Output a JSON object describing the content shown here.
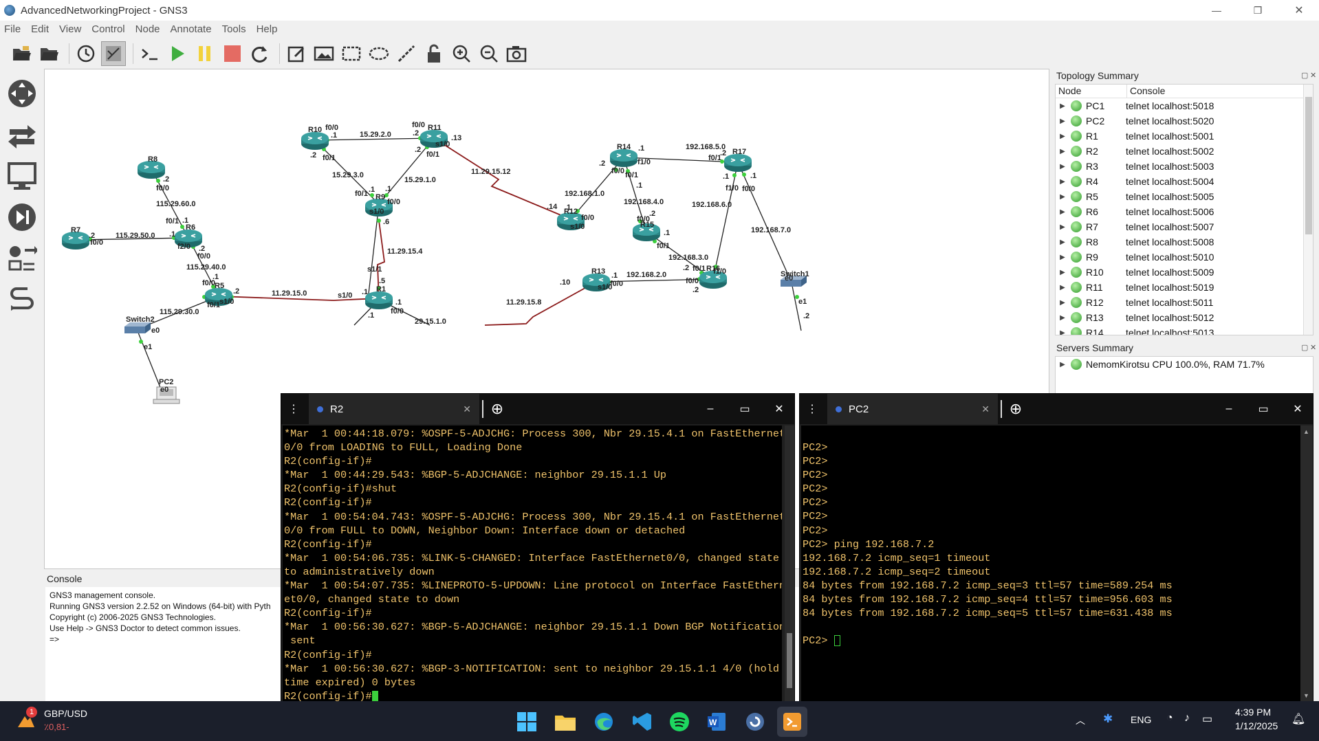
{
  "window": {
    "title": "AdvancedNetworkingProject - GNS3",
    "minimize": "—",
    "maximize": "❐",
    "close": "✕"
  },
  "menu": [
    "File",
    "Edit",
    "View",
    "Control",
    "Node",
    "Annotate",
    "Tools",
    "Help"
  ],
  "toolbar": {
    "icons": [
      "open-project-icon",
      "open-folder-icon",
      "snapshot-icon",
      "show-interfaces-icon",
      "console-all-icon",
      "start-icon",
      "suspend-icon",
      "stop-icon",
      "reload-icon",
      "note-icon",
      "image-icon",
      "rectangle-icon",
      "ellipse-icon",
      "line-icon",
      "lock-icon",
      "zoom-in-icon",
      "zoom-out-icon",
      "screenshot-icon"
    ]
  },
  "leftdock": {
    "icons": [
      "browse-routers-icon",
      "browse-switches-icon",
      "browse-end-devices-icon",
      "browse-security-icon",
      "browse-all-devices-icon",
      "add-link-icon"
    ]
  },
  "topology": {
    "nodes": [
      {
        "name": "R8",
        "type": "router"
      },
      {
        "name": "R7",
        "type": "router"
      },
      {
        "name": "R6",
        "type": "router"
      },
      {
        "name": "R5",
        "type": "router"
      },
      {
        "name": "R10",
        "type": "router"
      },
      {
        "name": "R11",
        "type": "router"
      },
      {
        "name": "R9",
        "type": "router"
      },
      {
        "name": "R1",
        "type": "router"
      },
      {
        "name": "R12",
        "type": "router"
      },
      {
        "name": "R14",
        "type": "router"
      },
      {
        "name": "R15",
        "type": "router"
      },
      {
        "name": "R13",
        "type": "router"
      },
      {
        "name": "R16",
        "type": "router"
      },
      {
        "name": "R17",
        "type": "router"
      },
      {
        "name": "Switch2",
        "type": "switch"
      },
      {
        "name": "Switch1",
        "type": "switch"
      },
      {
        "name": "PC2",
        "type": "pc"
      }
    ],
    "labels": [
      ".2",
      "f0/0",
      "115.29.60.0",
      "f0/1",
      ".1",
      ".2",
      ".1",
      "f0/0",
      "115.29.50.0",
      "f2/0",
      ".2",
      "f0/0",
      "115.29.40.0",
      ".1",
      "f0/0",
      ".2",
      "s1/0",
      "f0/1",
      "11.29.15.0",
      "s1/0",
      ".1",
      "115.29.30.0",
      "e0",
      "e1",
      "e0",
      "f0/0",
      "f0/0",
      ".1",
      "15.29.2.0",
      ".2",
      ".13",
      "s1/0",
      ".2",
      "f0/1",
      ".2",
      "f0/1",
      "15.29.3.0",
      "15.29.1.0",
      "f0/1",
      ".1",
      ".1",
      "f0/0",
      "s1/0",
      ".6",
      "11.29.15.4",
      "s1/1",
      ".5",
      ".1",
      "f0/0",
      "29.15.1.0",
      ".1",
      "11.29.15.12",
      ".14",
      ".1",
      "f0/0",
      "s1/0",
      "192.168.1.0",
      ".2",
      "f0/0",
      ".1",
      "f1/0",
      "f0/1",
      ".1",
      "192.168.4.0",
      "f0/0",
      ".2",
      ".1",
      "f0/1",
      "192.168.3.0",
      ".2",
      "f0/1",
      "f1/0",
      ".2",
      "192.168.5.0",
      ".2",
      "f0/1",
      ".1",
      ".1",
      "f1/0",
      "f0/0",
      "192.168.6.0",
      "192.168.7.0",
      ".10",
      ".1",
      "f0/0",
      "s1/0",
      "192.168.2.0",
      "f0/0",
      ".2",
      "11.29.15.8",
      "e0",
      "e1",
      ".2"
    ]
  },
  "console_dock": {
    "title": "Console",
    "lines": [
      "GNS3 management console.",
      "Running GNS3 version 2.2.52 on Windows (64-bit) with Pyth",
      "Copyright (c) 2006-2025 GNS3 Technologies.",
      "Use Help -> GNS3 Doctor to detect common issues.",
      "",
      "=>"
    ]
  },
  "topology_summary": {
    "title": "Topology Summary",
    "col_node": "Node",
    "col_console": "Console",
    "rows": [
      {
        "node": "PC1",
        "console": "telnet localhost:5018"
      },
      {
        "node": "PC2",
        "console": "telnet localhost:5020"
      },
      {
        "node": "R1",
        "console": "telnet localhost:5001"
      },
      {
        "node": "R2",
        "console": "telnet localhost:5002"
      },
      {
        "node": "R3",
        "console": "telnet localhost:5003"
      },
      {
        "node": "R4",
        "console": "telnet localhost:5004"
      },
      {
        "node": "R5",
        "console": "telnet localhost:5005"
      },
      {
        "node": "R6",
        "console": "telnet localhost:5006"
      },
      {
        "node": "R7",
        "console": "telnet localhost:5007"
      },
      {
        "node": "R8",
        "console": "telnet localhost:5008"
      },
      {
        "node": "R9",
        "console": "telnet localhost:5010"
      },
      {
        "node": "R10",
        "console": "telnet localhost:5009"
      },
      {
        "node": "R11",
        "console": "telnet localhost:5019"
      },
      {
        "node": "R12",
        "console": "telnet localhost:5011"
      },
      {
        "node": "R13",
        "console": "telnet localhost:5012"
      },
      {
        "node": "R14",
        "console": "telnet localhost:5013"
      }
    ]
  },
  "servers_summary": {
    "title": "Servers Summary",
    "server": "NemomKirotsu CPU 100.0%, RAM 71.7%"
  },
  "terminal_r2": {
    "tab": "R2",
    "lines": [
      "*Mar  1 00:44:18.079: %OSPF-5-ADJCHG: Process 300, Nbr 29.15.4.1 on FastEthernet",
      "0/0 from LOADING to FULL, Loading Done",
      "R2(config-if)#",
      "*Mar  1 00:44:29.543: %BGP-5-ADJCHANGE: neighbor 29.15.1.1 Up",
      "R2(config-if)#shut",
      "R2(config-if)#",
      "*Mar  1 00:54:04.743: %OSPF-5-ADJCHG: Process 300, Nbr 29.15.4.1 on FastEthernet",
      "0/0 from FULL to DOWN, Neighbor Down: Interface down or detached",
      "R2(config-if)#",
      "*Mar  1 00:54:06.735: %LINK-5-CHANGED: Interface FastEthernet0/0, changed state",
      "to administratively down",
      "*Mar  1 00:54:07.735: %LINEPROTO-5-UPDOWN: Line protocol on Interface FastEthern",
      "et0/0, changed state to down",
      "R2(config-if)#",
      "*Mar  1 00:56:30.627: %BGP-5-ADJCHANGE: neighbor 29.15.1.1 Down BGP Notification",
      " sent",
      "R2(config-if)#",
      "*Mar  1 00:56:30.627: %BGP-3-NOTIFICATION: sent to neighbor 29.15.1.1 4/0 (hold",
      "time expired) 0 bytes"
    ],
    "prompt": "R2(config-if)#"
  },
  "terminal_pc2": {
    "tab": "PC2",
    "lines": [
      "",
      "PC2>",
      "PC2>",
      "PC2>",
      "PC2>",
      "PC2>",
      "PC2>",
      "PC2>",
      "PC2> ping 192.168.7.2",
      "192.168.7.2 icmp_seq=1 timeout",
      "192.168.7.2 icmp_seq=2 timeout",
      "84 bytes from 192.168.7.2 icmp_seq=3 ttl=57 time=589.254 ms",
      "84 bytes from 192.168.7.2 icmp_seq=4 ttl=57 time=956.603 ms",
      "84 bytes from 192.168.7.2 icmp_seq=5 ttl=57 time=631.438 ms",
      ""
    ],
    "prompt": "PC2> "
  },
  "taskbar": {
    "widget_title": "GBP/USD",
    "widget_value": "٪0,81-",
    "widget_badge": "1",
    "lang": "ENG",
    "time": "4:39 PM",
    "date": "1/12/2025"
  },
  "colors": {
    "terminal_text": "#f0c36b",
    "terminal_bg": "#000000",
    "router": "#2f8f8f",
    "link_serial": "#8b1a1a",
    "status_green": "#2f9a2a"
  }
}
